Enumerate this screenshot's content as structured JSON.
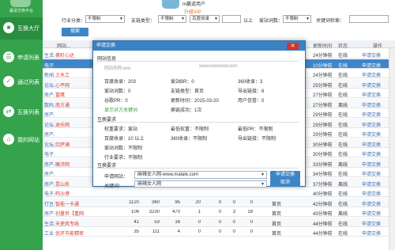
{
  "sidebar": {
    "brand_text": "赢道交换平台",
    "items": [
      {
        "label": "互换大厅",
        "icon": "building-icon",
        "active": true
      },
      {
        "label": "申请列表",
        "icon": "list-icon",
        "active": false
      },
      {
        "label": "通过列表",
        "icon": "check-icon",
        "active": false
      },
      {
        "label": "互换列表",
        "icon": "exchange-icon",
        "active": false
      },
      {
        "label": "我的网站",
        "icon": "home-icon",
        "active": false
      }
    ]
  },
  "header": {
    "user_name": "m赢道用户",
    "upgrade": "升级VIP"
  },
  "filters": {
    "industry_label": "行业分类：",
    "industry_value": "不限制",
    "link_type_label": "友链类型：",
    "link_type_value": "不限制",
    "baidu_value": "百度收录",
    "above": "以上",
    "friend_label": "爱站词数：",
    "friend_value": "不限制",
    "keyword_label": "关键词检索：",
    "search_button": "搜索"
  },
  "table": {
    "headers": {
      "site": "网站...",
      "time": "更新时间",
      "status": "状态",
      "action": "操作"
    },
    "rows": [
      {
        "name": "生活...",
        "red": "豪町心达",
        "time": "24分钟前",
        "status": "在线",
        "action": "申请交换",
        "highlight": false
      },
      {
        "name": "电子...",
        "red": "",
        "time": "10分钟前",
        "status": "在线",
        "action": "申请交换",
        "highlight": true
      },
      {
        "name": "新闻...",
        "red": "土木工",
        "time": "24分钟前",
        "status": "在线",
        "action": "申请交换",
        "highlight": false
      },
      {
        "name": "论坛...",
        "red": "心平网",
        "time": "25分钟前",
        "status": "在线",
        "action": "申请交换",
        "highlight": false
      },
      {
        "name": "房产...",
        "red": "富鹰",
        "time": "27分钟前",
        "status": "在线",
        "action": "申请交换",
        "highlight": false
      },
      {
        "name": "数码...",
        "red": "南方通",
        "time": "27分钟前",
        "status": "离线",
        "action": "申请交换",
        "highlight": false
      },
      {
        "name": "房产...",
        "red": "",
        "time": "29分钟前",
        "status": "在线",
        "action": "申请交换",
        "highlight": false
      },
      {
        "name": "论坛...",
        "red": "途乐网",
        "time": "29分钟前",
        "status": "在线",
        "action": "申请交换",
        "highlight": false
      },
      {
        "name": "房产...",
        "red": "",
        "time": "29分钟前",
        "status": "在线",
        "action": "申请交换",
        "highlight": false
      },
      {
        "name": "论坛...",
        "red": "红萨满",
        "time": "30分钟前",
        "status": "在线",
        "action": "申请交换",
        "highlight": false
      },
      {
        "name": "电子...",
        "red": "",
        "time": "30分钟前",
        "status": "在线",
        "action": "申请交换",
        "highlight": false
      },
      {
        "name": "房产...",
        "red": "瞰济网",
        "time": "33分钟前",
        "status": "离线",
        "action": "申请交换",
        "highlight": false
      },
      {
        "name": "房产...",
        "red": "",
        "time": "34分钟前",
        "status": "在线",
        "action": "申请交换",
        "highlight": false
      },
      {
        "name": "房产...",
        "red": "昆山系",
        "time": "37分钟前",
        "status": "离线",
        "action": "申请交换",
        "highlight": false
      },
      {
        "name": "电子...",
        "red": "鸣沙港",
        "time": "40分钟前",
        "status": "在线",
        "action": "申请交换",
        "highlight": false
      }
    ],
    "bottom_rows": [
      {
        "name": "打豆...",
        "red": "智能一卡通",
        "n": [
          "1120",
          "360",
          "95",
          "20",
          "0",
          "0",
          "0"
        ],
        "page": "首页",
        "time": "42分钟前",
        "status": "在线",
        "action": "申请交换"
      },
      {
        "name": "房产...",
        "red": "创量世【重网",
        "n": [
          "106",
          "3230",
          "470",
          "1",
          "0",
          "3",
          "18"
        ],
        "page": "首页",
        "time": "43分钟前",
        "status": "离线",
        "action": "申请交换"
      },
      {
        "name": "生活...",
        "red": "天使风专线",
        "n": [
          "41",
          "53",
          "16",
          "0",
          "0",
          "0",
          "0"
        ],
        "page": "首页",
        "time": "44分钟前",
        "status": "在线",
        "action": "申请交换"
      },
      {
        "name": "工业...",
        "red": "优环节能精密",
        "n": [
          "35",
          "111",
          "4",
          "0",
          "0",
          "0",
          "0"
        ],
        "page": "首页",
        "time": "44分钟前",
        "status": "在线",
        "action": "申请交换"
      }
    ]
  },
  "modal": {
    "title": "申请交换",
    "site_info_title": "网站信息",
    "site_name_blur": "网站名称:xxxx",
    "site_url_blur": "www.xxxxxxxxxx.com",
    "info": {
      "baidu": "百度收录：203",
      "aizhan": "爱站BR：0",
      "s360": "360收录：3",
      "aizhan_words": "爱站词数：0",
      "link_type": "友链类型：首页",
      "export_links": "导出链接：6",
      "google_pr": "谷歌PR：0",
      "update_time": "更新时间：2015-03-20",
      "user_credit": "用户信誉：0",
      "show_keywords": "显示对方关键词",
      "ex_success": "换链成功：1次"
    },
    "req_title": "互换要求",
    "req": {
      "weight": "权重要求：爱站",
      "min_weight": "最低权重：不限制",
      "min_pr": "最低PR：不限制",
      "baidu_req": "百度收录：10 以上",
      "s360_req": "360收录：不限制",
      "export_req": "导出链接：不限制",
      "aizhan_req": "爱站词数：不限制",
      "industry_req": "行业要求：不限制"
    },
    "apply_title": "互换要求",
    "apply_site_label": "申请网站：",
    "apply_site_value": "麻辣女人网-www.malale.com",
    "keyword_label": "关键词：",
    "keyword_value": "麻辣女人网",
    "apply_button": "申请交换",
    "cancel_button": "取消"
  }
}
